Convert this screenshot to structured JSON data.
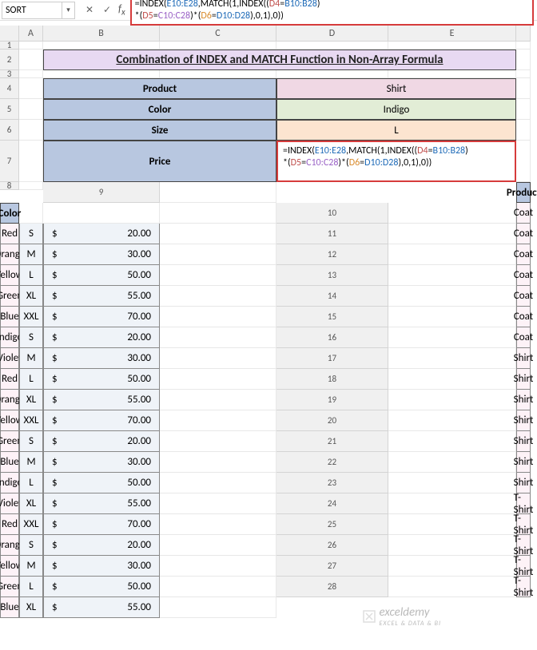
{
  "namebox": "SORT",
  "formula_bar": {
    "line1_pre": "=INDEX(",
    "r1": "E10:E28",
    "mid1": ",MATCH(1,INDEX((",
    "r2": "D4",
    "eq1": "=",
    "r3": "B10:B28",
    "close1": ")",
    "line2_pre": "*(",
    "r4": "D5",
    "eq2": "=",
    "r5": "C10:C28",
    "mid2": ")*(",
    "r6": "D6",
    "eq3": "=",
    "r7": "D10:D28",
    "close2": "),0,1),0))"
  },
  "columns": [
    "A",
    "B",
    "C",
    "D",
    "E"
  ],
  "title": "Combination of INDEX and MATCH Function in Non-Array Formula",
  "labels": {
    "product": "Product",
    "color": "Color",
    "size": "Size",
    "price": "Price"
  },
  "values": {
    "product": "Shirt",
    "color": "Indigo",
    "size": "L"
  },
  "formula_cell": {
    "part1": "=INDEX(",
    "p1a": "E10:E28",
    "part2": ",MATCH(1,INDEX((",
    "p2a": "D4",
    "eq": "=",
    "p2b": "B10:B28",
    "part3": ")",
    "line2a": "*(",
    "p3a": "D5",
    "p3b": "C10:C28",
    "line2b": ")*(",
    "p4a": "D6",
    "p4b": "D10:D28",
    "line2c": "),0,1),0))"
  },
  "table_headers": {
    "b": "Product",
    "c": "Color"
  },
  "rows": [
    {
      "b": "Coat",
      "c": "Red",
      "d": "S",
      "e": "20.00"
    },
    {
      "b": "Coat",
      "c": "Orange",
      "d": "M",
      "e": "30.00"
    },
    {
      "b": "Coat",
      "c": "Yellow",
      "d": "L",
      "e": "50.00"
    },
    {
      "b": "Coat",
      "c": "Green",
      "d": "XL",
      "e": "55.00"
    },
    {
      "b": "Coat",
      "c": "Blue",
      "d": "XXL",
      "e": "70.00"
    },
    {
      "b": "Coat",
      "c": "Indigo",
      "d": "S",
      "e": "20.00"
    },
    {
      "b": "Coat",
      "c": "Violet",
      "d": "M",
      "e": "30.00"
    },
    {
      "b": "Shirt",
      "c": "Red",
      "d": "L",
      "e": "50.00"
    },
    {
      "b": "Shirt",
      "c": "Orange",
      "d": "XL",
      "e": "55.00"
    },
    {
      "b": "Shirt",
      "c": "Yellow",
      "d": "XXL",
      "e": "70.00"
    },
    {
      "b": "Shirt",
      "c": "Green",
      "d": "S",
      "e": "20.00"
    },
    {
      "b": "Shirt",
      "c": "Blue",
      "d": "M",
      "e": "30.00"
    },
    {
      "b": "Shirt",
      "c": "Indigo",
      "d": "L",
      "e": "50.00"
    },
    {
      "b": "Shirt",
      "c": "Violet",
      "d": "XL",
      "e": "55.00"
    },
    {
      "b": "T-Shirt",
      "c": "Red",
      "d": "XXL",
      "e": "70.00"
    },
    {
      "b": "T-Shirt",
      "c": "Orange",
      "d": "S",
      "e": "20.00"
    },
    {
      "b": "T-Shirt",
      "c": "Yellow",
      "d": "M",
      "e": "30.00"
    },
    {
      "b": "T-Shirt",
      "c": "Green",
      "d": "L",
      "e": "50.00"
    },
    {
      "b": "T-Shirt",
      "c": "Blue",
      "d": "XL",
      "e": "55.00"
    }
  ],
  "currency": "$",
  "watermark": "exceldemy",
  "watermark_sub": "EXCEL & DATA & BI"
}
